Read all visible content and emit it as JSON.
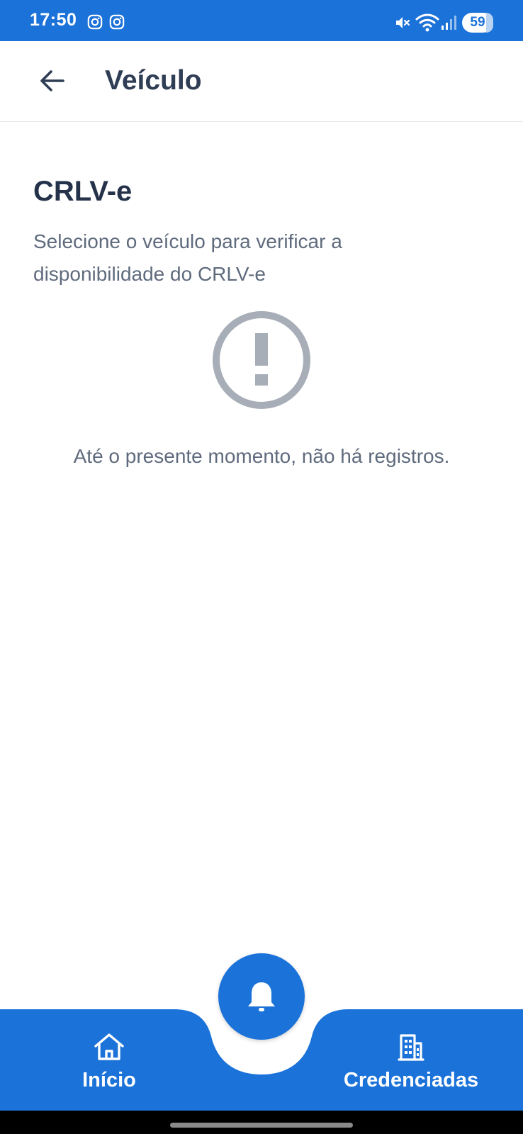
{
  "status_bar": {
    "time": "17:50",
    "battery": "59",
    "icons": [
      "instagram-icon",
      "instagram-icon",
      "mute-icon",
      "wifi-icon",
      "signal-icon"
    ]
  },
  "app_bar": {
    "title": "Veículo",
    "back_icon": "arrow-left-icon"
  },
  "main": {
    "title": "CRLV-e",
    "subtitle": "Selecione o veículo para verificar a disponibilidade do CRLV-e",
    "empty_icon": "exclamation-circle-icon",
    "empty_message": "Até o presente momento, não há registros."
  },
  "bottom_nav": {
    "items": [
      {
        "label": "Início",
        "icon": "home-icon"
      },
      {
        "label": "Credenciadas",
        "icon": "building-icon"
      }
    ],
    "fab_icon": "bell-icon"
  },
  "colors": {
    "primary": "#1b72d8",
    "title_text": "#24324a",
    "body_text": "#5f6b7d",
    "icon_gray": "#a7aeb8"
  }
}
